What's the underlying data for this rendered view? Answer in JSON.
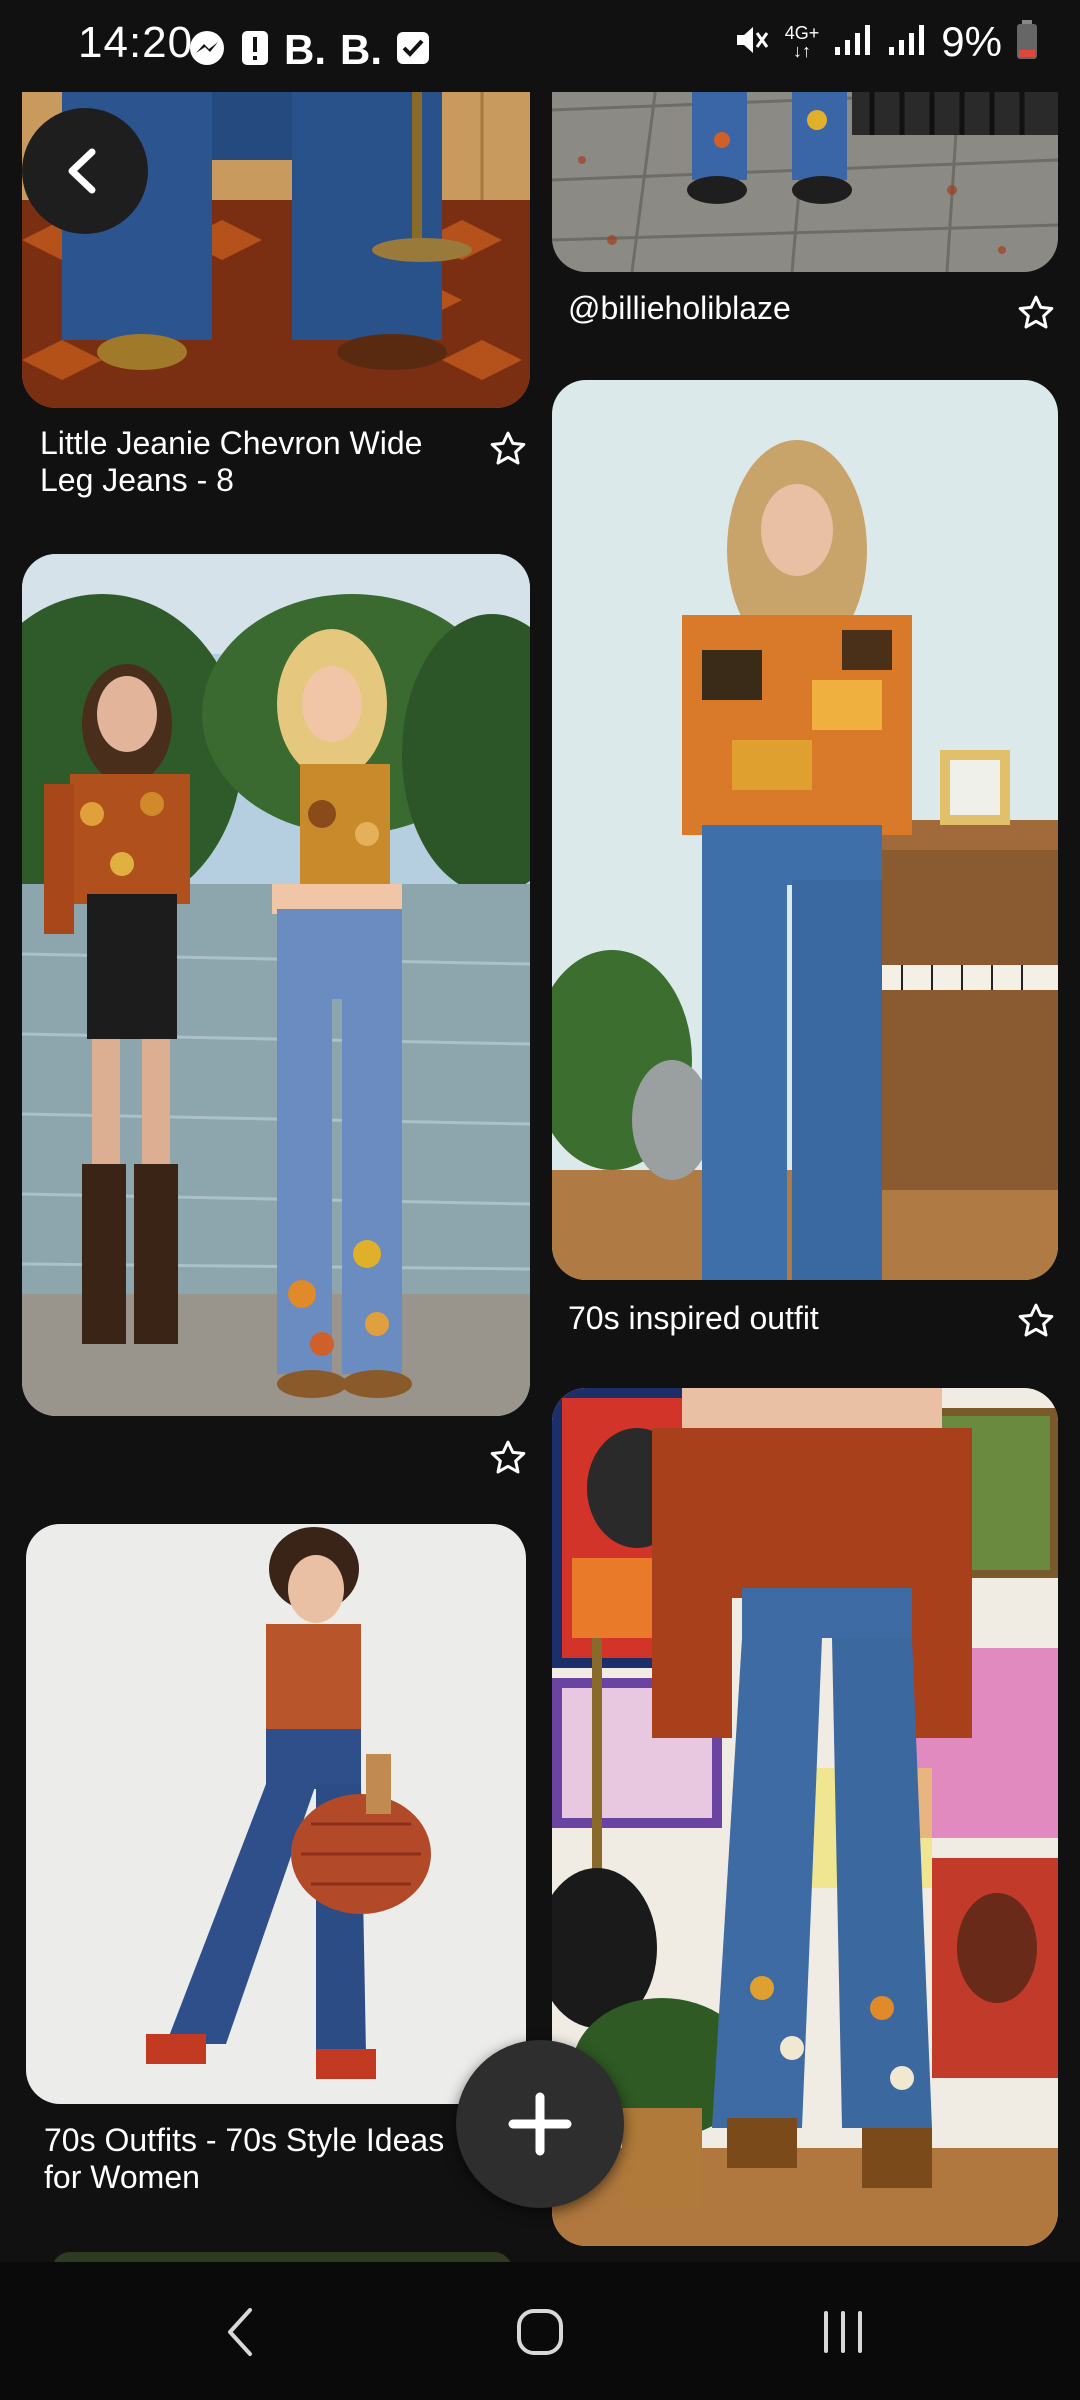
{
  "status_bar": {
    "time": "14:20",
    "notification_icons": [
      "messenger-icon",
      "alert-icon",
      "bb-app-icon",
      "bb-app-icon",
      "checkbox-icon"
    ],
    "network_label": "4G+",
    "battery": "9%"
  },
  "navigation": {
    "back_icon": "chevron-left-icon"
  },
  "pins": [
    {
      "caption": "Little Jeanie Chevron Wide Leg Jeans - 8",
      "column": "left"
    },
    {
      "caption": "@billieholiblaze",
      "column": "right"
    },
    {
      "caption": "",
      "column": "left"
    },
    {
      "caption": "70s inspired outfit",
      "column": "right"
    },
    {
      "caption": "70s Outfits - 70s Style Ideas for Women",
      "column": "left"
    },
    {
      "caption": "",
      "column": "right"
    }
  ],
  "fab": {
    "icon": "plus-icon"
  },
  "system_nav": {
    "icons": [
      "back-nav-icon",
      "home-nav-icon",
      "recents-nav-icon"
    ]
  },
  "colors": {
    "background": "#111111",
    "card_radius_color": "#1e1e1e",
    "text": "#ffffff",
    "battery_low": "#e0463c"
  }
}
